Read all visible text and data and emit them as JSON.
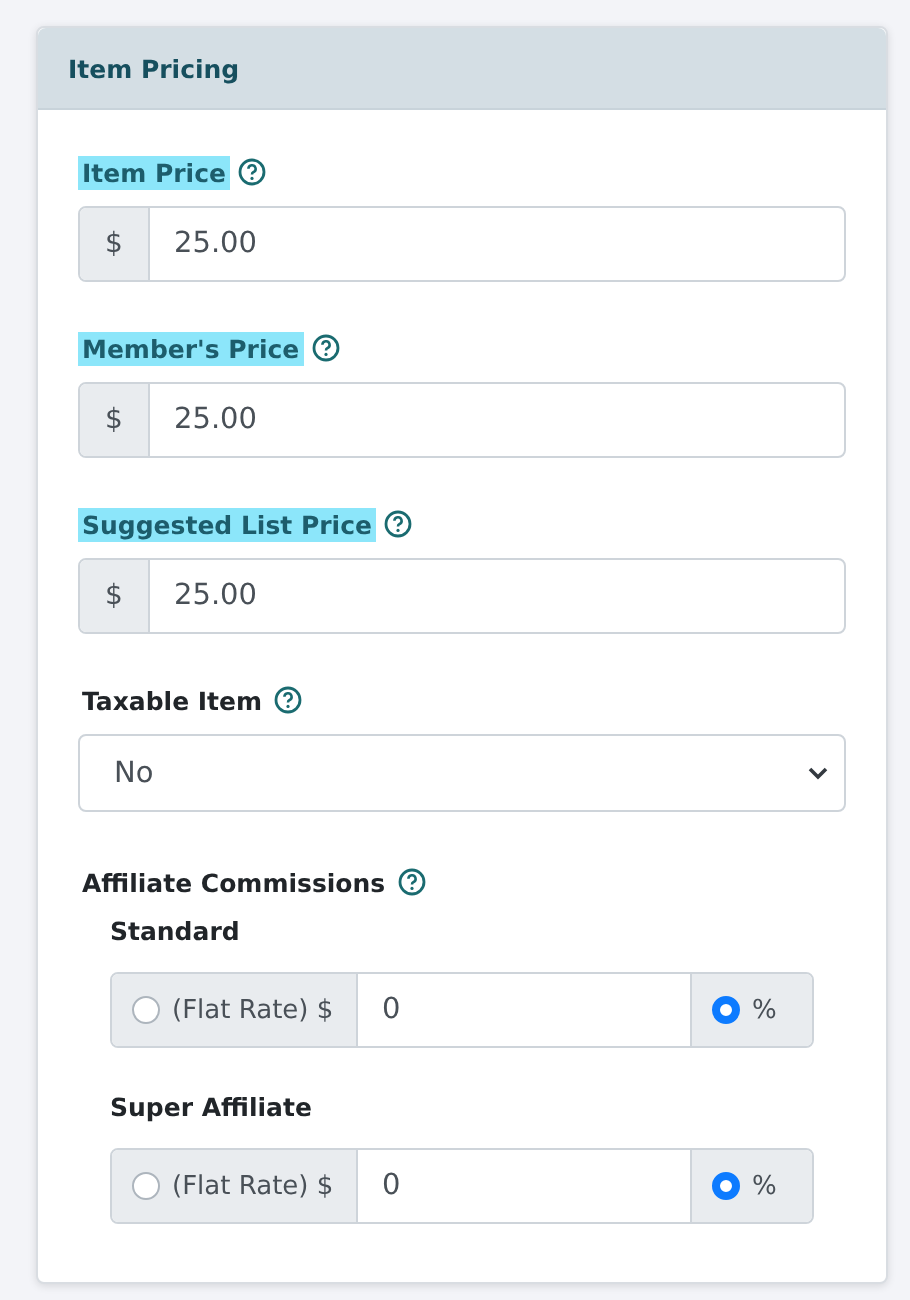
{
  "panel": {
    "title": "Item Pricing"
  },
  "price_fields": [
    {
      "label": "Item Price",
      "highlighted": true,
      "prefix": "$",
      "value": "25.00"
    },
    {
      "label": "Member's Price",
      "highlighted": true,
      "prefix": "$",
      "value": "25.00"
    },
    {
      "label": "Suggested List Price",
      "highlighted": true,
      "prefix": "$",
      "value": "25.00"
    }
  ],
  "taxable": {
    "label": "Taxable Item",
    "value": "No"
  },
  "affiliate": {
    "label": "Affiliate Commissions",
    "tiers": [
      {
        "label": "Standard",
        "value": "0",
        "rate_options": [
          {
            "label": "(Flat Rate) $",
            "selected": false
          },
          {
            "label": "%",
            "selected": true
          }
        ]
      },
      {
        "label": "Super Affiliate",
        "value": "0",
        "rate_options": [
          {
            "label": "(Flat Rate) $",
            "selected": false
          },
          {
            "label": "%",
            "selected": true
          }
        ]
      }
    ]
  }
}
